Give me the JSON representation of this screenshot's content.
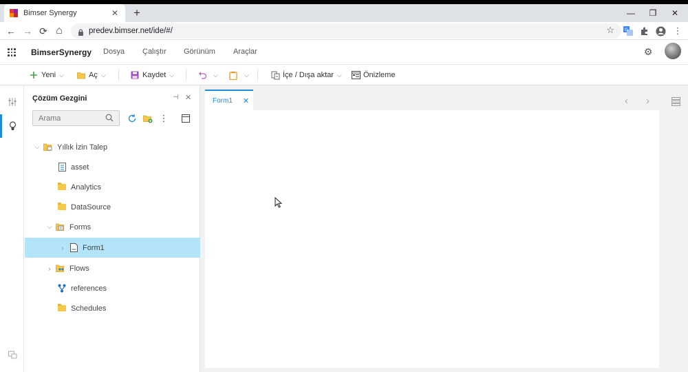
{
  "browser": {
    "tab_title": "Bimser Synergy",
    "tab_close": "✕",
    "new_tab": "+",
    "window_controls": {
      "minimize": "—",
      "restore": "❐",
      "close": "✕"
    },
    "url": "predev.bimser.net/ide/#/",
    "nav": {
      "back": "←",
      "forward": "→",
      "reload": "⟳",
      "home": "⌂"
    },
    "bookmark_icon": "star-icon",
    "kebab": "⋮"
  },
  "app": {
    "brand": "BimserSynergy",
    "menu": [
      "Dosya",
      "Çalıştır",
      "Görünüm",
      "Araçlar"
    ],
    "settings_icon": "gear-icon",
    "accent_color": "#1e8ad6"
  },
  "toolbar": {
    "new_label": "Yeni",
    "open_label": "Aç",
    "save_label": "Kaydet",
    "import_export_label": "İçe / Dışa aktar",
    "preview_label": "Önizleme"
  },
  "explorer": {
    "title": "Çözüm Gezgini",
    "search_placeholder": "Arama",
    "pin": "⊣",
    "close": "✕",
    "tree": [
      {
        "label": "Yıllık İzin Talep",
        "arrow": "⌵",
        "icon": "project-icon"
      },
      {
        "label": "asset",
        "arrow": "",
        "icon": "asset-icon"
      },
      {
        "label": "Analytics",
        "arrow": "",
        "icon": "folder-icon"
      },
      {
        "label": "DataSource",
        "arrow": "",
        "icon": "folder-icon"
      },
      {
        "label": "Forms",
        "arrow": "⌵",
        "icon": "forms-folder-icon"
      },
      {
        "label": "Form1",
        "arrow": "›",
        "icon": "form-file-icon",
        "selected": true
      },
      {
        "label": "Flows",
        "arrow": "›",
        "icon": "flows-folder-icon"
      },
      {
        "label": "references",
        "arrow": "",
        "icon": "references-icon"
      },
      {
        "label": "Schedules",
        "arrow": "",
        "icon": "folder-icon"
      }
    ]
  },
  "editor": {
    "tab_label": "Form1",
    "tab_close": "✕",
    "nav_prev": "‹",
    "nav_next": "›"
  }
}
